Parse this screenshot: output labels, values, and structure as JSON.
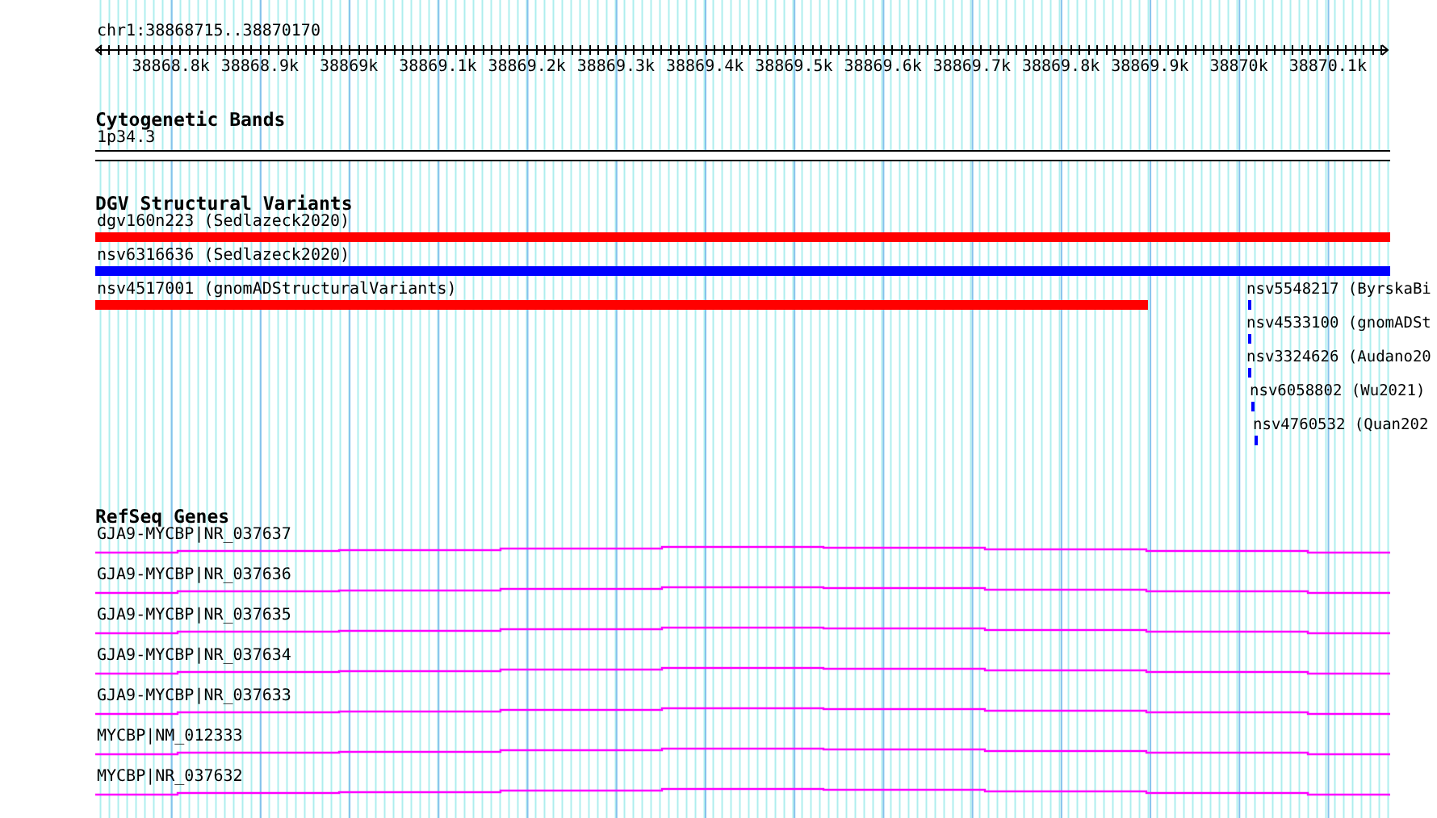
{
  "ruler": {
    "location": "chr1:38868715..38870170",
    "tick_labels": [
      "38868.8k",
      "38868.9k",
      "38869k",
      "38869.1k",
      "38869.2k",
      "38869.3k",
      "38869.4k",
      "38869.5k",
      "38869.6k",
      "38869.7k",
      "38869.8k",
      "38869.9k",
      "38870k",
      "38870.1k"
    ]
  },
  "cytogenetic_bands": {
    "title": "Cytogenetic Bands",
    "band": "1p34.3"
  },
  "structural_variants": {
    "title": "DGV Structural Variants",
    "features": [
      {
        "kind": "span",
        "label": "dgv160n223 (Sedlazeck2020)",
        "color": "#ff0000"
      },
      {
        "kind": "span",
        "label": "nsv6316636 (Sedlazeck2020)",
        "color": "#0000ff"
      },
      {
        "kind": "span",
        "label": "nsv4517001 (gnomADStructuralVariants)",
        "color": "#ff0000"
      },
      {
        "kind": "point",
        "label": "nsv5548217 (ByrskaBi",
        "color": "#0000ff"
      },
      {
        "kind": "point",
        "label": "nsv4533100 (gnomADSt",
        "color": "#0000ff"
      },
      {
        "kind": "point",
        "label": "nsv3324626 (Audano20",
        "color": "#0000ff"
      },
      {
        "kind": "point",
        "label": "nsv6058802 (Wu2021)",
        "color": "#0000ff"
      },
      {
        "kind": "point",
        "label": "nsv4760532 (Quan202",
        "color": "#0000ff"
      }
    ]
  },
  "refseq_genes": {
    "title": "RefSeq Genes",
    "transcripts": [
      {
        "label": "GJA9-MYCBP|NR_037637"
      },
      {
        "label": "GJA9-MYCBP|NR_037636"
      },
      {
        "label": "GJA9-MYCBP|NR_037635"
      },
      {
        "label": "GJA9-MYCBP|NR_037634"
      },
      {
        "label": "GJA9-MYCBP|NR_037633"
      },
      {
        "label": "MYCBP|NM_012333"
      },
      {
        "label": "MYCBP|NR_037632"
      }
    ]
  }
}
